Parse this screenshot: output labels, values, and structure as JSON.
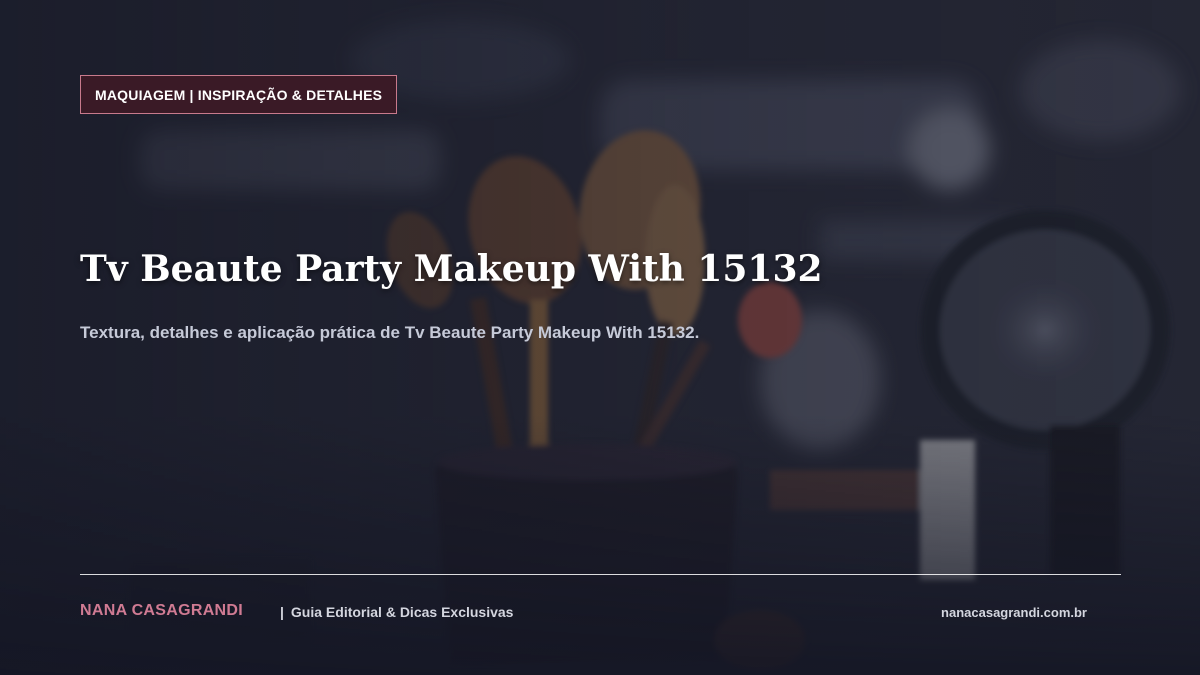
{
  "background": {
    "description_icon": "makeup-brushes-photo",
    "overlay_color": "#161826"
  },
  "badge": {
    "label": "MAQUIAGEM | INSPIRAÇÃO & DETALHES",
    "background_color": "#3a1a26",
    "border_color": "#c87a8c"
  },
  "article": {
    "title": "Tv Beaute Party Makeup With 15132",
    "subtitle": "Textura, detalhes e aplicação prática de Tv Beaute Party Makeup With 15132."
  },
  "footer": {
    "brand": "NANA CASAGRANDI",
    "brand_color": "#d07b93",
    "separator": "|",
    "tagline": "Guia Editorial & Dicas Exclusivas",
    "site": "nanacasagrandi.com.br"
  }
}
